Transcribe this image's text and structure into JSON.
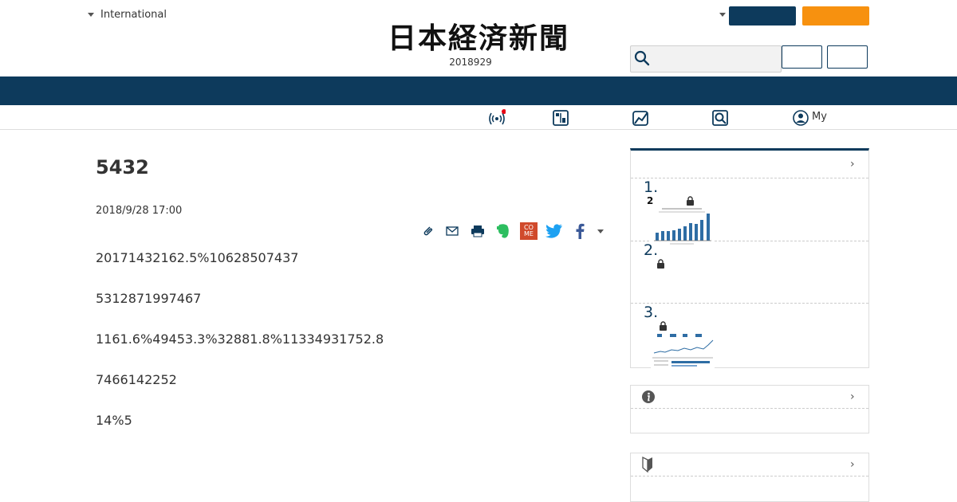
{
  "header": {
    "edition_label": "International",
    "logo_text": "日本経済新聞",
    "date": "2018929",
    "my_label": "My"
  },
  "article": {
    "title": "5432",
    "published": "2018/9/28 17:00",
    "paragraphs": [
      "20171432162.5%10628507437",
      "5312871997467",
      "1161.6%49453.3%32881.8%11334931752.8",
      "7466142252",
      "14%5"
    ]
  },
  "ranking": {
    "items": [
      {
        "rank": "1.",
        "badge": "2"
      },
      {
        "rank": "2."
      },
      {
        "rank": "3."
      }
    ]
  },
  "share": {
    "come_label": "CO ME"
  },
  "colors": {
    "navy": "#0d3a5c",
    "orange": "#f7910f",
    "evernote": "#2dbe60",
    "twitter": "#1da1f2",
    "facebook": "#3b5998",
    "come": "#d04a2c"
  }
}
